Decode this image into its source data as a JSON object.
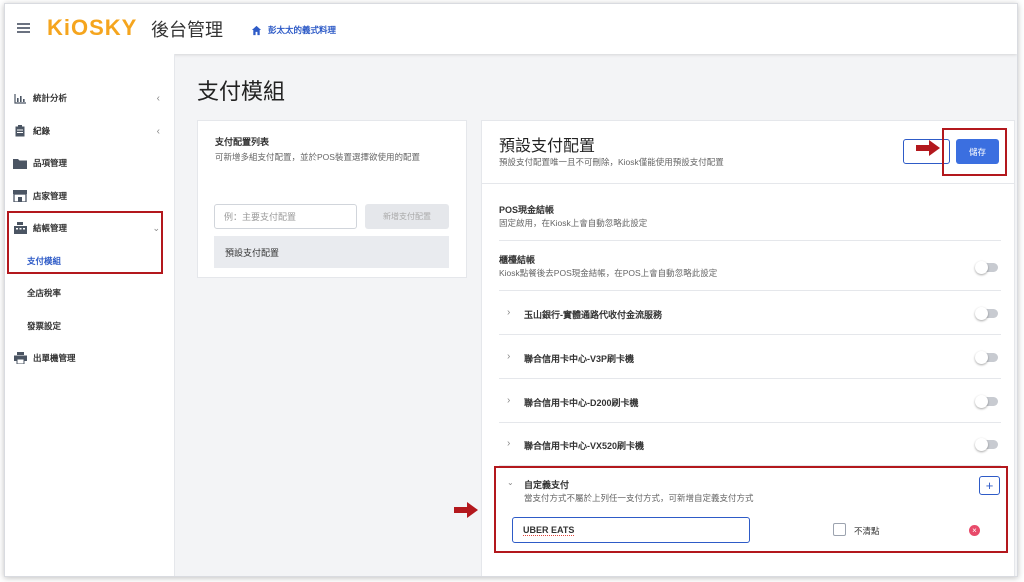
{
  "header": {
    "brand": "KiOSKY",
    "title": "後台管理",
    "store_name": "彭太太的義式料理"
  },
  "sidebar": {
    "items": [
      {
        "label": "統計分析",
        "icon": "bar-chart-icon",
        "expandable": true
      },
      {
        "label": "紀錄",
        "icon": "clipboard-icon",
        "expandable": true
      },
      {
        "label": "品項管理",
        "icon": "folder-icon",
        "expandable": false
      },
      {
        "label": "店家管理",
        "icon": "store-icon",
        "expandable": false
      },
      {
        "label": "結帳管理",
        "icon": "cash-register-icon",
        "expandable": true,
        "expanded": true
      },
      {
        "label": "出單機管理",
        "icon": "printer-icon",
        "expandable": false
      }
    ],
    "sub_items": [
      {
        "label": "支付模組",
        "active": true
      },
      {
        "label": "全店稅率",
        "active": false
      },
      {
        "label": "發票設定",
        "active": false
      }
    ]
  },
  "page": {
    "title": "支付模組"
  },
  "left_card": {
    "title": "支付配置列表",
    "desc": "可新增多組支付配置，並於POS裝置選擇欲使用的配置",
    "input_placeholder": "例：主要支付配置",
    "add_button": "新增支付配置",
    "list": [
      "預設支付配置"
    ]
  },
  "right_card": {
    "title": "預設支付配置",
    "desc": "預設支付配置唯一且不可刪除，Kiosk僅能使用預設支付配置",
    "save_button": "儲存",
    "rows": {
      "pos_cash_title": "POS現金結帳",
      "pos_cash_desc": "固定啟用，在Kiosk上會自動忽略此設定",
      "counter_title": "櫃檯結帳",
      "counter_desc": "Kiosk點餐後去POS現金結帳，在POS上會自動忽略此設定",
      "group1": "玉山銀行-實體通路代收付金流服務",
      "group2": "聯合信用卡中心-V3P刷卡機",
      "group3": "聯合信用卡中心-D200刷卡機",
      "group4": "聯合信用卡中心-VX520刷卡機",
      "custom_title": "自定義支付",
      "custom_desc": "當支付方式不屬於上列任一支付方式，可新增自定義支付方式"
    },
    "custom_entry": {
      "value": "UBER EATS",
      "checkbox_label": "不清點",
      "checked": false
    },
    "toggles": {
      "counter": false,
      "group1": false,
      "group2": false,
      "group3": false,
      "group4": false
    }
  },
  "colors": {
    "brand_orange": "#f5a51e",
    "primary_blue": "#3b6fe0",
    "annotation_red": "#b3181d",
    "danger_pink": "#e84a6a"
  }
}
